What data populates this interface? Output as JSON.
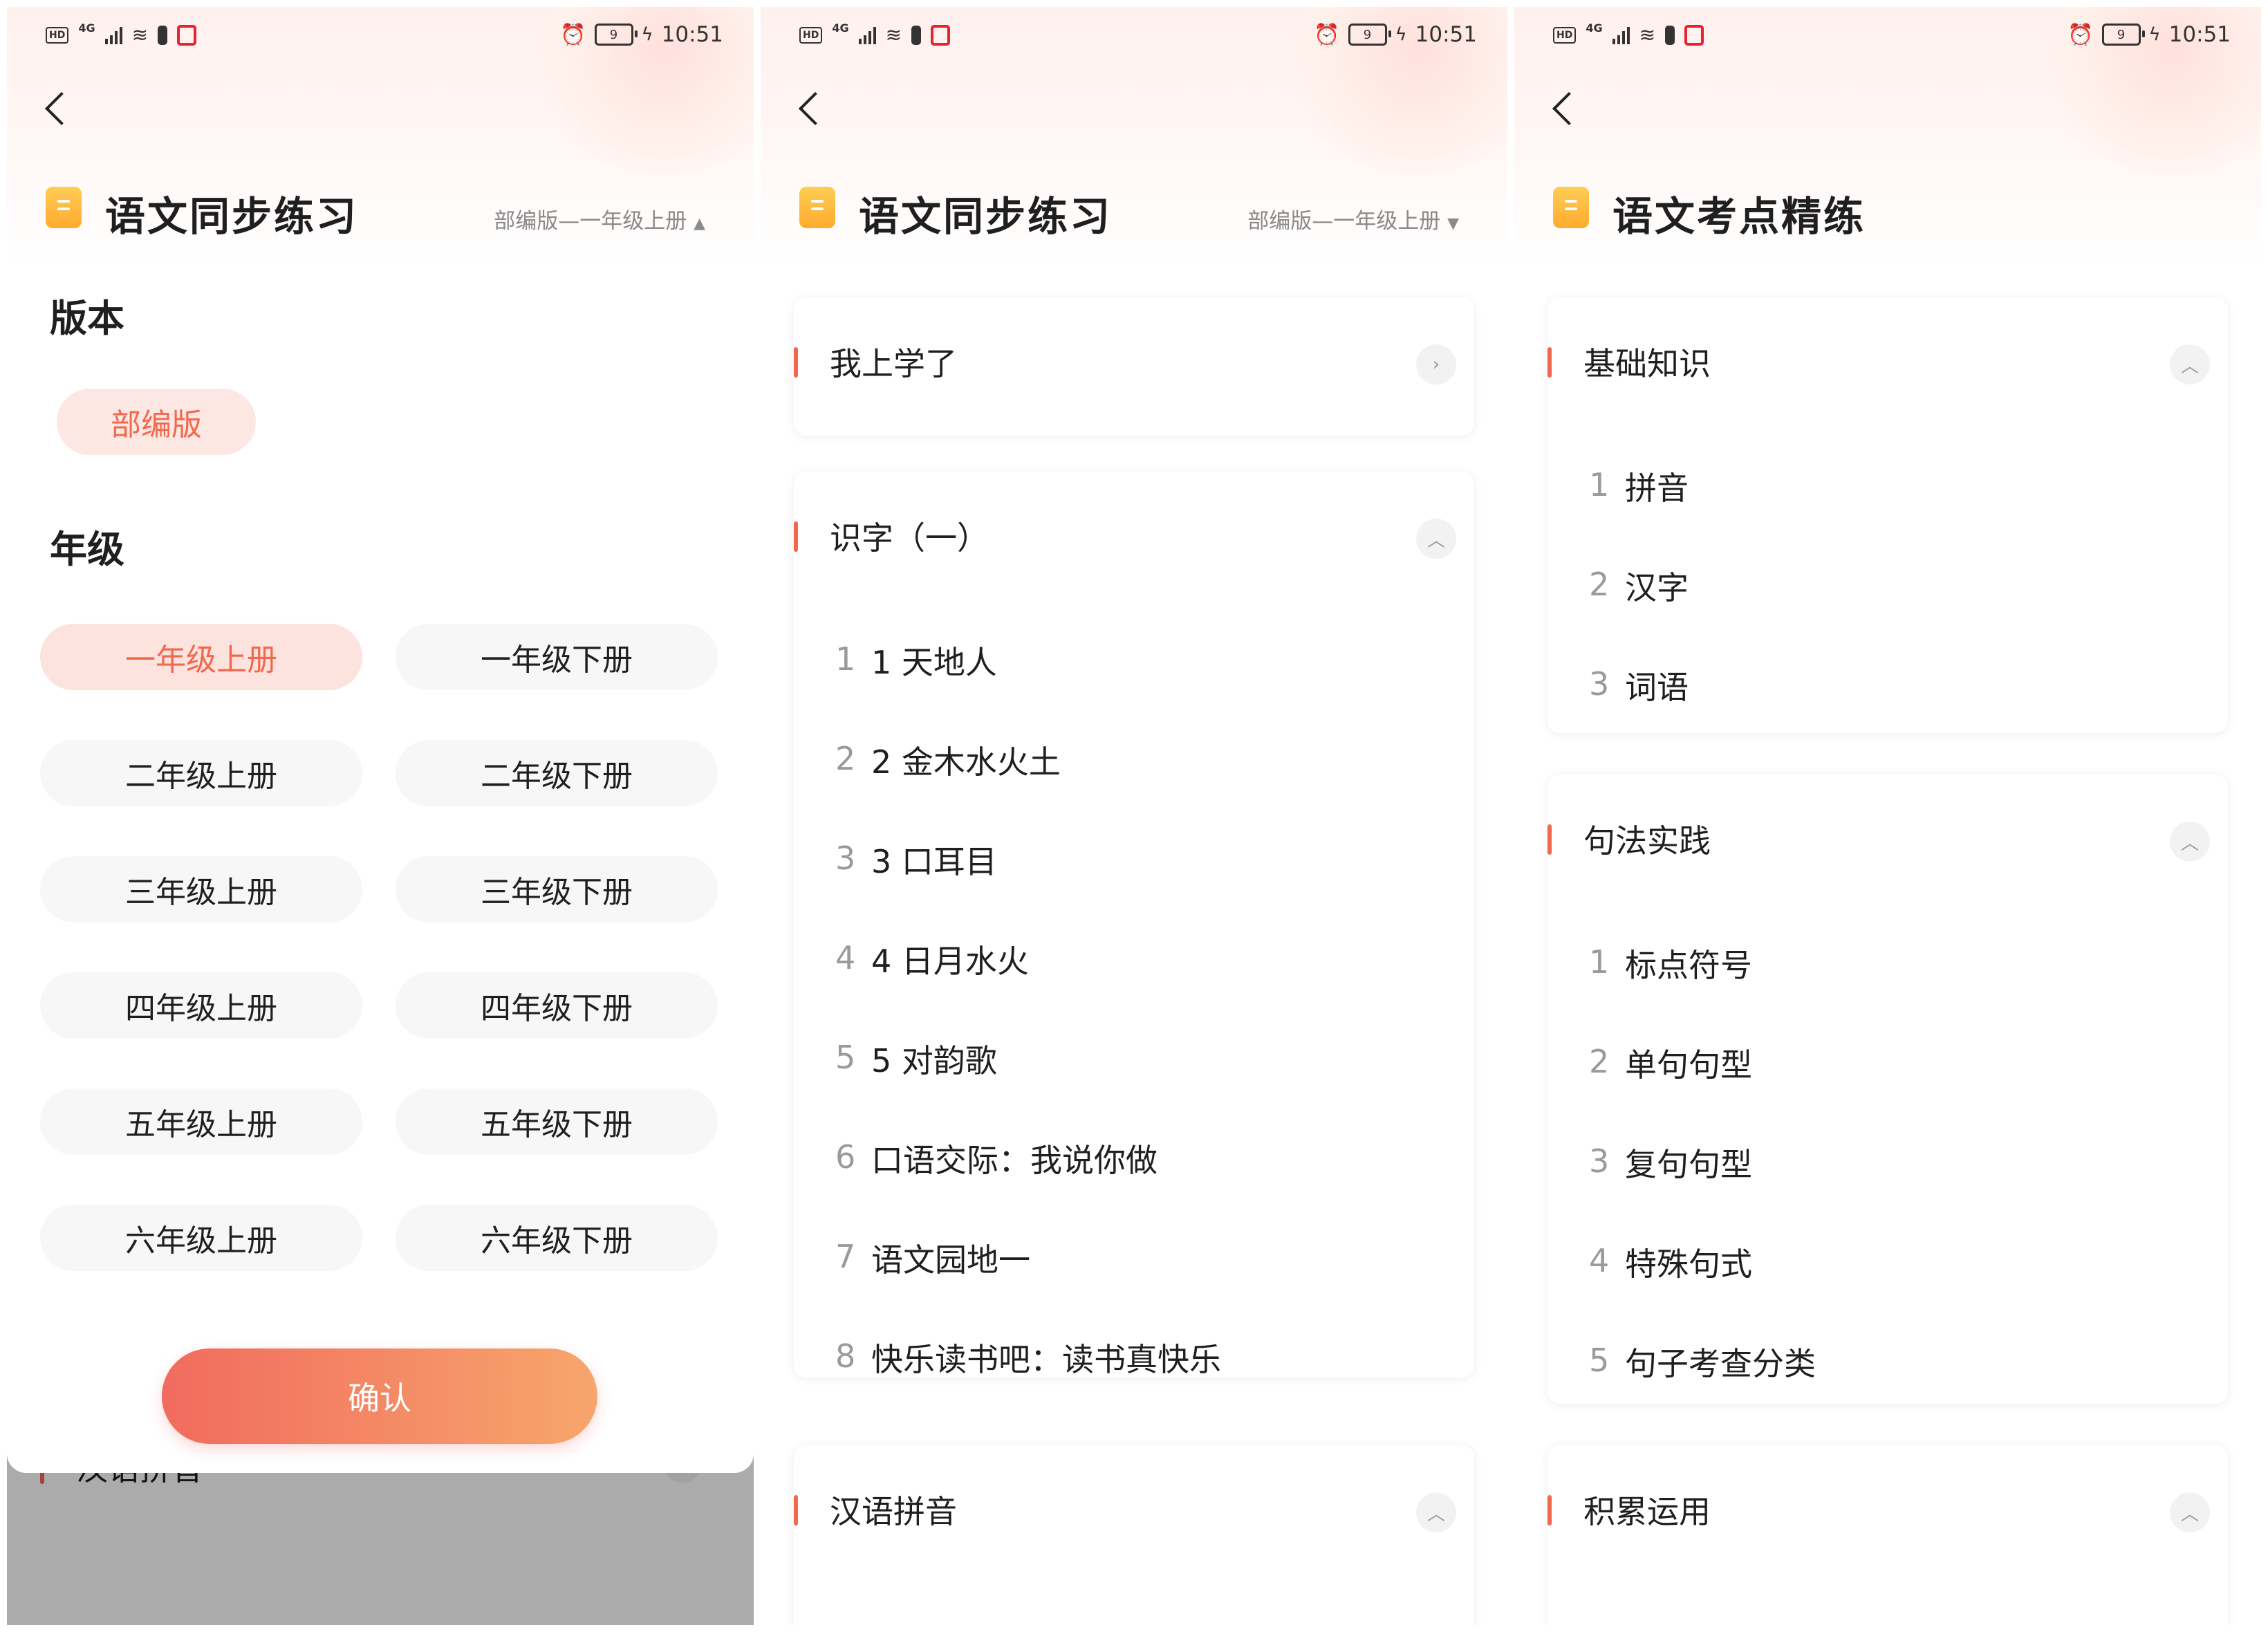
{
  "status_bar": {
    "time": "10:51",
    "network": "4G",
    "hd": "HD",
    "battery": "9"
  },
  "colors": {
    "accent": "#f2684e",
    "button_gradient": [
      "#f16b5e",
      "#f7a66c"
    ],
    "book_icon": "#ffbb40"
  },
  "icons": [
    "chevron-left-icon",
    "book-icon",
    "wifi-icon",
    "battery-icon",
    "alarm-icon",
    "chevron-up-icon",
    "chevron-right-icon"
  ],
  "screen1": {
    "title": "语文同步练习",
    "picker": "部编版—一年级上册",
    "version_heading": "版本",
    "version_chip": "部编版",
    "grade_heading": "年级",
    "selected_grade": "一年级上册",
    "grades": [
      "一年级上册",
      "一年级下册",
      "二年级上册",
      "二年级下册",
      "三年级上册",
      "三年级下册",
      "四年级上册",
      "四年级下册",
      "五年级上册",
      "五年级下册",
      "六年级上册",
      "六年级下册"
    ],
    "confirm": "确认",
    "behind_card": "汉语拼音"
  },
  "screen2": {
    "title": "语文同步练习",
    "picker": "部编版—一年级上册",
    "cards": [
      {
        "title": "我上学了",
        "expanded": false,
        "items": []
      },
      {
        "title": "识字（一）",
        "expanded": true,
        "items": [
          {
            "num": "1",
            "label": "1 天地人"
          },
          {
            "num": "2",
            "label": "2 金木水火土"
          },
          {
            "num": "3",
            "label": "3 口耳目"
          },
          {
            "num": "4",
            "label": "4 日月水火"
          },
          {
            "num": "5",
            "label": "5 对韵歌"
          },
          {
            "num": "6",
            "label": "口语交际：我说你做"
          },
          {
            "num": "7",
            "label": "语文园地一"
          },
          {
            "num": "8",
            "label": "快乐读书吧：读书真快乐"
          }
        ]
      },
      {
        "title": "汉语拼音",
        "expanded": true,
        "items": []
      }
    ]
  },
  "screen3": {
    "title": "语文考点精练",
    "cards": [
      {
        "title": "基础知识",
        "expanded": true,
        "items": [
          {
            "num": "1",
            "label": "拼音"
          },
          {
            "num": "2",
            "label": "汉字"
          },
          {
            "num": "3",
            "label": "词语"
          }
        ]
      },
      {
        "title": "句法实践",
        "expanded": true,
        "items": [
          {
            "num": "1",
            "label": "标点符号"
          },
          {
            "num": "2",
            "label": "单句句型"
          },
          {
            "num": "3",
            "label": "复句句型"
          },
          {
            "num": "4",
            "label": "特殊句式"
          },
          {
            "num": "5",
            "label": "句子考查分类"
          }
        ]
      },
      {
        "title": "积累运用",
        "expanded": true,
        "items": []
      }
    ]
  }
}
